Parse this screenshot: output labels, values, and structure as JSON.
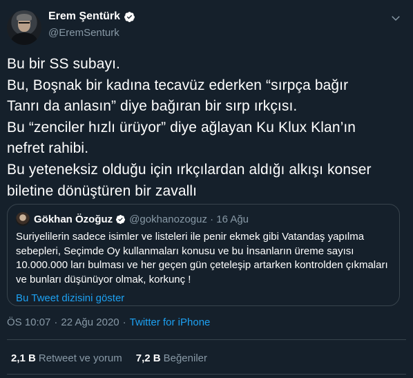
{
  "author": {
    "name": "Erem Şentürk",
    "handle": "@EremSenturk"
  },
  "tweet": {
    "lines": [
      "Bu bir SS subayı.",
      "Bu, Boşnak bir kadına tecavüz ederken “sırpça bağır",
      "Tanrı da anlasın” diye bağıran bir sırp ırkçısı.",
      "Bu “zenciler hızlı ürüyor” diye ağlayan Ku Klux Klan’ın",
      "nefret rahibi.",
      "Bu yeteneksiz olduğu için ırkçılardan aldığı alkışı konser",
      "biletine dönüştüren bir zavallı"
    ]
  },
  "quote": {
    "name": "Gökhan Özoğuz",
    "meta": "@gokhanozoguz · 16 Ağu",
    "lines": [
      "Suriyelilerin sadece isimler ve listeleri ile penir ekmek gibi Vatandaş yapılma",
      "sebepleri, Seçimde Oy kullanmaları konusu ve bu İnsanların üreme sayısı",
      "10.000.000 ları bulması ve her geçen gün çeteleşip artarken kontrolden çıkmaları",
      "ve bunları düşünüyor olmak, korkunç !"
    ],
    "thread_link": "Bu Tweet dizisini göster"
  },
  "meta": {
    "time": "ÖS 10:07",
    "separator": "·",
    "date": "22 Ağu 2020",
    "source": "Twitter for iPhone"
  },
  "stats": {
    "retweets_count": "2,1 B",
    "retweets_label": "Retweet ve yorum",
    "likes_count": "7,2 B",
    "likes_label": "Beğeniler"
  },
  "colors": {
    "background": "#15202b",
    "accent": "#1da1f2",
    "muted": "#8899a6",
    "border": "#38444d"
  },
  "icons": {
    "verified": "verified-badge-icon",
    "menu": "chevron-down-icon"
  }
}
